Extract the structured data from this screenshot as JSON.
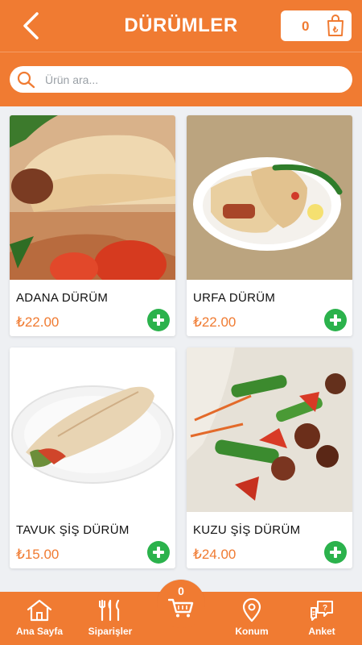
{
  "header": {
    "title": "DÜRÜMLER",
    "cart_count": "0",
    "currency_symbol": "₺"
  },
  "search": {
    "placeholder": "Ürün ara..."
  },
  "products": [
    {
      "name": "ADANA DÜRÜM",
      "price": "₺22.00"
    },
    {
      "name": "URFA DÜRÜM",
      "price": "₺22.00"
    },
    {
      "name": "TAVUK ŞİŞ DÜRÜM",
      "price": "₺15.00"
    },
    {
      "name": "KUZU ŞİŞ DÜRÜM",
      "price": "₺24.00"
    }
  ],
  "bottom_nav": {
    "home_label": "Ana Sayfa",
    "orders_label": "Siparişler",
    "cart_count": "0",
    "location_label": "Konum",
    "survey_label": "Anket"
  },
  "colors": {
    "brand_orange": "#f07b32",
    "add_green": "#2bb24c",
    "background": "#eef0f3"
  },
  "icons": {
    "back": "chevron-left-icon",
    "cart": "shopping-bag-icon",
    "search": "search-icon",
    "add": "plus-circle-icon",
    "home": "home-icon",
    "orders": "cutlery-icon",
    "basket": "shopping-cart-icon",
    "location": "map-pin-icon",
    "survey": "chat-question-icon"
  }
}
